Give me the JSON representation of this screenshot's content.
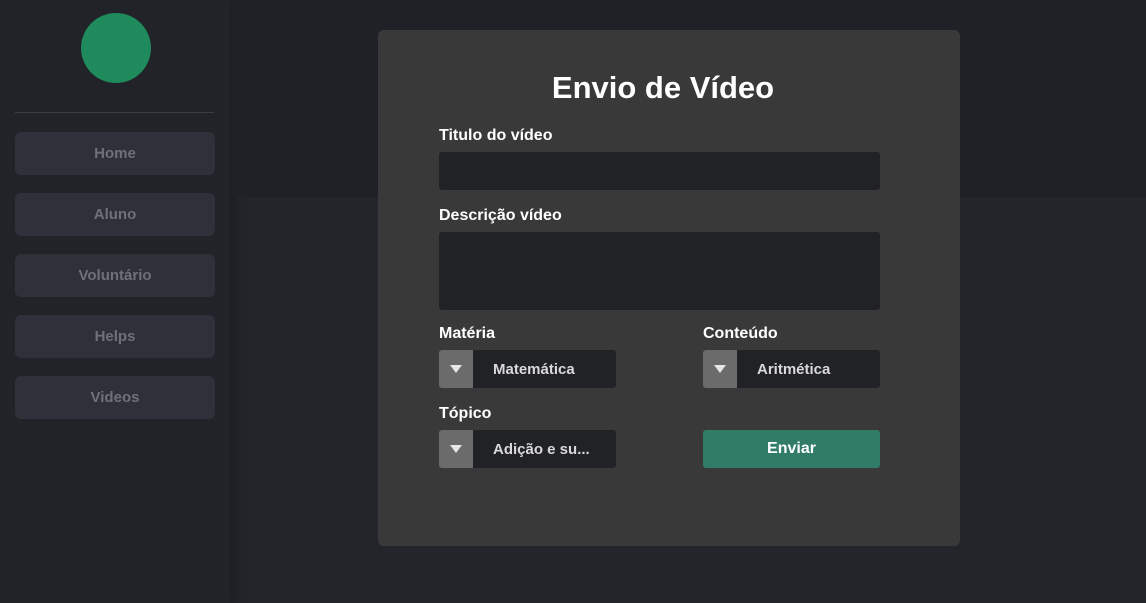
{
  "sidebar": {
    "items": [
      {
        "label": "Home"
      },
      {
        "label": "Aluno"
      },
      {
        "label": "Voluntário"
      },
      {
        "label": "Helps"
      },
      {
        "label": "Videos"
      }
    ]
  },
  "form": {
    "title": "Envio de Vídeo",
    "title_field": {
      "label": "Titulo do vídeo",
      "value": ""
    },
    "description_field": {
      "label": "Descrição vídeo",
      "value": ""
    },
    "materia": {
      "label": "Matéria",
      "selected": "Matemática"
    },
    "conteudo": {
      "label": "Conteúdo",
      "selected": "Aritmética"
    },
    "topico": {
      "label": "Tópico",
      "selected": "Adição e su..."
    },
    "submit_label": "Enviar"
  },
  "colors": {
    "accent": "#317c67",
    "avatar": "#1f8a5b"
  },
  "icons": {
    "dropdown": "caret-down-icon"
  }
}
